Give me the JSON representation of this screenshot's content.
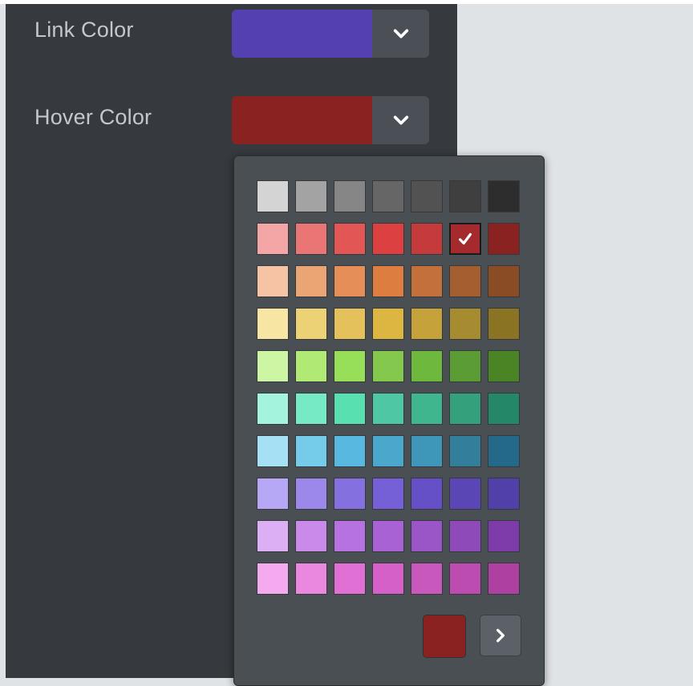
{
  "settings": {
    "link_color": {
      "label": "Link Color",
      "value": "#5440b0"
    },
    "hover_color": {
      "label": "Hover Color",
      "value": "#8b2222"
    }
  },
  "icons": {
    "dropdown": "chevron-down-icon",
    "selected": "checkmark-icon",
    "next": "chevron-right-icon"
  },
  "palette": {
    "selected_color": "#a52a2d",
    "rows": [
      [
        "#d4d4d4",
        "#a3a3a3",
        "#868686",
        "#666666",
        "#525252",
        "#3f3f3f",
        "#2d2d2d"
      ],
      [
        "#f4a5a5",
        "#ea7575",
        "#e25656",
        "#dd4040",
        "#c53a3a",
        "#a52a2d",
        "#8b2222"
      ],
      [
        "#f6c3a4",
        "#eba574",
        "#e58e58",
        "#dd7d40",
        "#c4703a",
        "#a55e30",
        "#8a4c25"
      ],
      [
        "#f7e6a3",
        "#ecd275",
        "#e4c15a",
        "#dcb640",
        "#c5a23a",
        "#a78b30",
        "#8a7424"
      ],
      [
        "#ccf5a4",
        "#b0ea74",
        "#97df58",
        "#84c84d",
        "#6eb83e",
        "#5b9c35",
        "#4a8424"
      ],
      [
        "#a4f3dc",
        "#75eac5",
        "#58e0b0",
        "#4ec8a4",
        "#40b68e",
        "#34a07c",
        "#248868"
      ],
      [
        "#a5e0f4",
        "#75cbea",
        "#58b8e0",
        "#4aa8cc",
        "#3e96b8",
        "#327f9c",
        "#24688a"
      ],
      [
        "#b6a8f4",
        "#9b88ea",
        "#8570e0",
        "#7660d8",
        "#6650c8",
        "#5a46b4",
        "#5040a8"
      ],
      [
        "#dcaef4",
        "#c98aea",
        "#b672e0",
        "#a862d4",
        "#9a55c6",
        "#8d4ab8",
        "#7e3caa"
      ],
      [
        "#f4aaee",
        "#ea88e0",
        "#e070d4",
        "#d460c8",
        "#c858bc",
        "#bc4caf",
        "#ae40a2"
      ]
    ]
  },
  "current": {
    "color": "#8b2222"
  }
}
